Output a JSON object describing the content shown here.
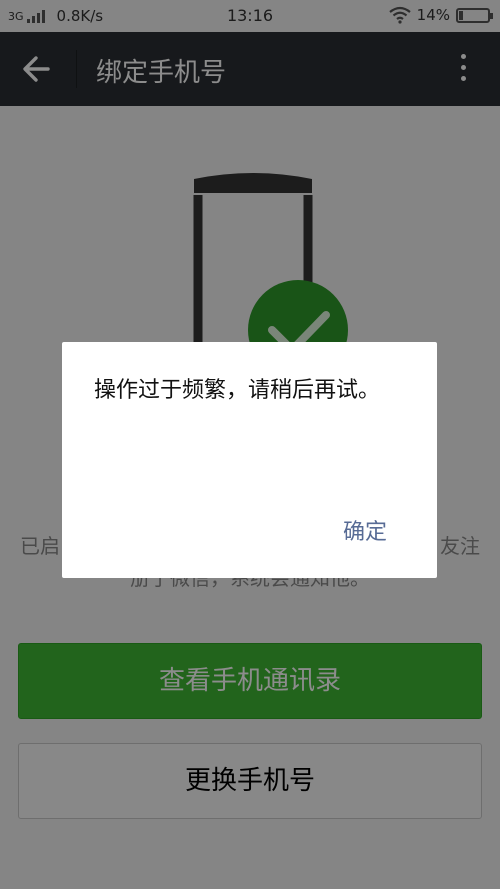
{
  "status_bar": {
    "network": "3G",
    "speed": "0.8K/s",
    "time": "13:16",
    "battery_percent": "14%",
    "battery_level": 0.14
  },
  "app_bar": {
    "title": "绑定手机号"
  },
  "content": {
    "description_lines": [
      "已启",
      "友注"
    ],
    "description_partial": "册了微信，系统会通知他。",
    "primary_button_label": "查看手机通讯录",
    "secondary_button_label": "更换手机号"
  },
  "dialog": {
    "message": "操作过于频繁，请稍后再试。",
    "confirm_label": "确定"
  },
  "colors": {
    "app_bar": "#2b2f33",
    "primary": "#3eb734",
    "dialog_action": "#576b95",
    "overlay": "rgba(0,0,0,0.45)"
  },
  "icons": {
    "back": "arrow-left-icon",
    "more": "more-vertical-icon",
    "wifi": "wifi-icon",
    "battery": "battery-icon",
    "signal": "signal-icon",
    "check": "check-icon"
  }
}
